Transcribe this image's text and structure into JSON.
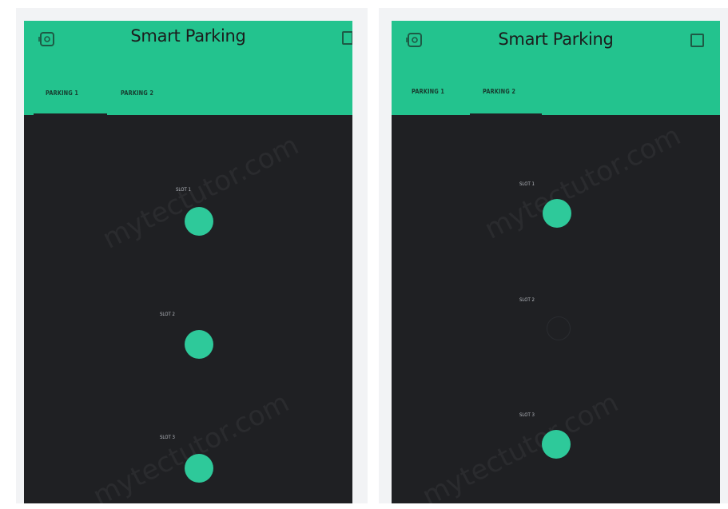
{
  "colors": {
    "header_green": "#23c38e",
    "app_background": "#1f2023",
    "led_on": "#2ec99a"
  },
  "screens": [
    {
      "title": "Smart Parking",
      "tabs": [
        {
          "label": "PARKING 1",
          "active": true
        },
        {
          "label": "PARKING 2",
          "active": false
        }
      ],
      "slots": [
        {
          "label": "SLOT 1",
          "state": "on"
        },
        {
          "label": "SLOT 2",
          "state": "on"
        },
        {
          "label": "SLOT 3",
          "state": "on"
        }
      ],
      "watermark": "mytectutor.com",
      "icons": {
        "left": "device-icon",
        "right": "square-icon"
      }
    },
    {
      "title": "Smart Parking",
      "tabs": [
        {
          "label": "PARKING 1",
          "active": false
        },
        {
          "label": "PARKING 2",
          "active": true
        }
      ],
      "slots": [
        {
          "label": "SLOT 1",
          "state": "on"
        },
        {
          "label": "SLOT 2",
          "state": "off"
        },
        {
          "label": "SLOT 3",
          "state": "on"
        }
      ],
      "watermark": "mytectutor.com",
      "icons": {
        "left": "device-icon",
        "right": "square-icon"
      }
    }
  ]
}
